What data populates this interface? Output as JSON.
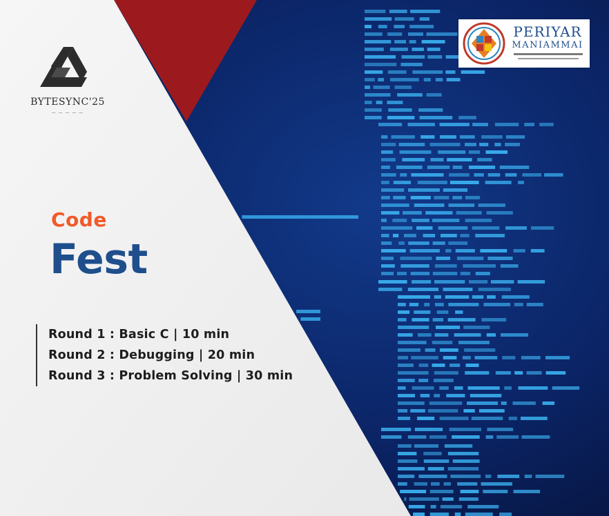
{
  "brand": {
    "name": "BYTESYNC'25",
    "icon": "triangular-knot-icon"
  },
  "partner_logo": {
    "line1": "PERIYAR",
    "line2": "MANIAMMAI",
    "icon": "university-seal-icon"
  },
  "event": {
    "title_small": "Code",
    "title_large": "Fest"
  },
  "rounds": [
    "Round 1 : Basic C | 10 min",
    "Round 2 : Debugging | 20 min",
    "Round 3 : Problem Solving | 30 min"
  ],
  "colors": {
    "background_white": "#f4f4f4",
    "background_navy": "#0a1b4d",
    "accent_red": "#9c1a1e",
    "code_text": "#3ab0f0",
    "title_orange": "#f15a29",
    "title_blue": "#1f4e8c"
  }
}
